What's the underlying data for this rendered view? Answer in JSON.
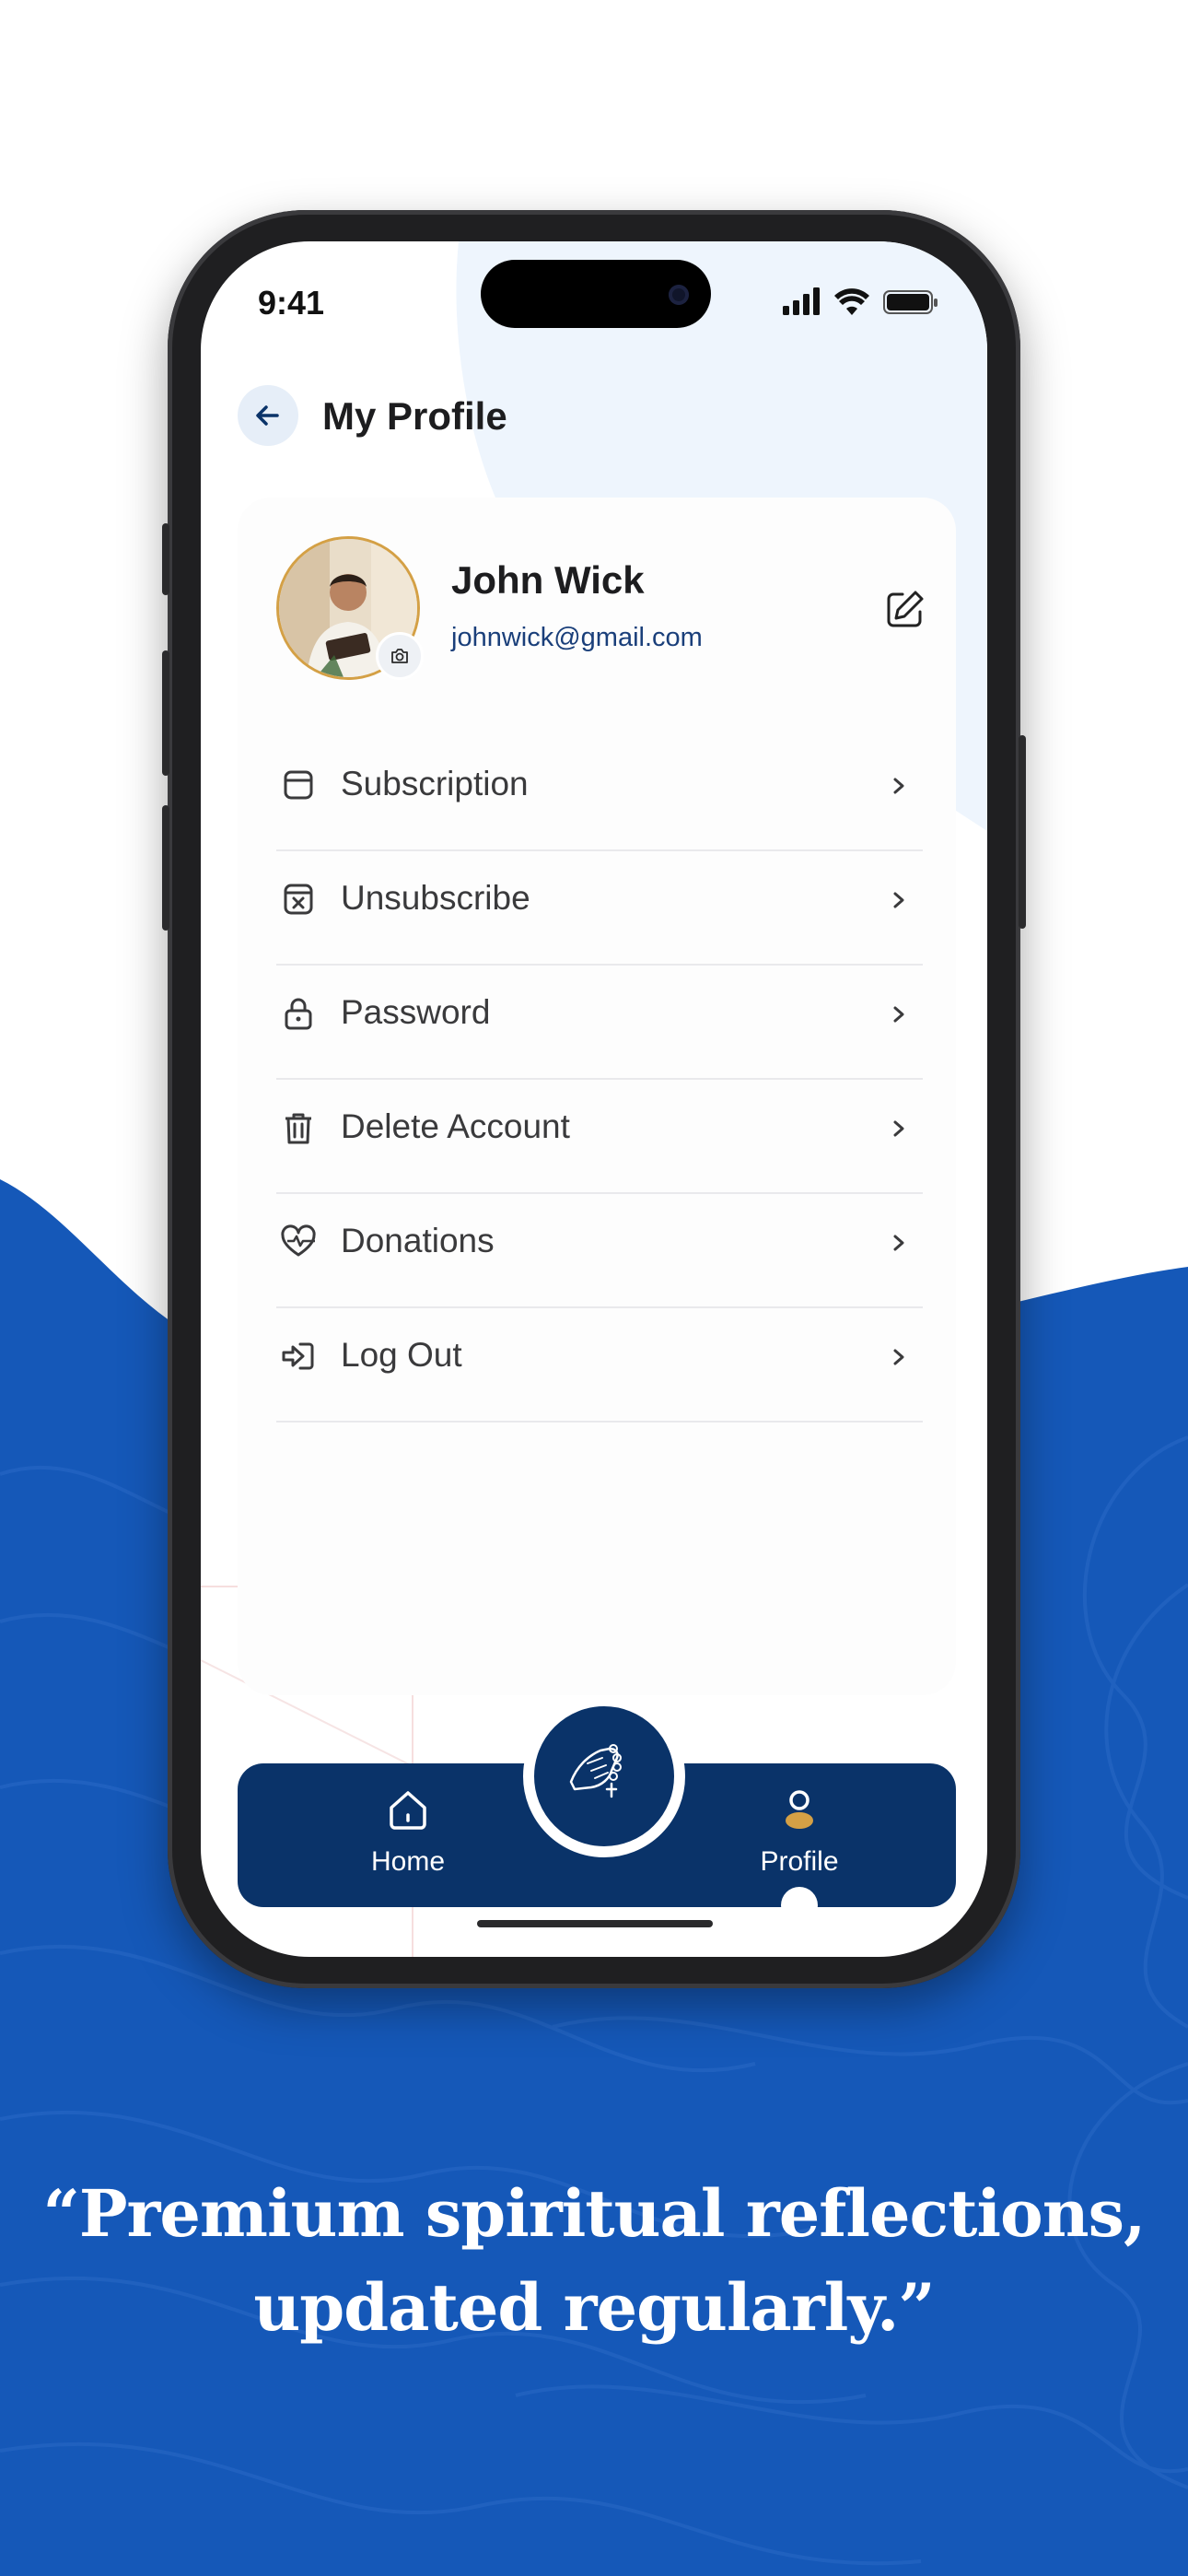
{
  "status_bar": {
    "time": "9:41"
  },
  "header": {
    "title": "My Profile"
  },
  "profile": {
    "name": "John Wick",
    "email": "johnwick@gmail.com"
  },
  "menu": [
    {
      "label": "Subscription",
      "icon": "card-icon"
    },
    {
      "label": " Unsubscribe",
      "icon": "unsubscribe-icon"
    },
    {
      "label": "Password",
      "icon": "lock-icon"
    },
    {
      "label": "Delete Account",
      "icon": "trash-icon"
    },
    {
      "label": "Donations",
      "icon": "heart-pulse-icon"
    },
    {
      "label": "Log Out",
      "icon": "logout-icon"
    }
  ],
  "tabbar": {
    "home_label": "Home",
    "profile_label": "Profile",
    "active": "Profile"
  },
  "tagline": {
    "line1": "“Premium spiritual reflections,",
    "line2": "updated regularly.”"
  },
  "colors": {
    "brand_blue": "#1558b8",
    "navy": "#0a3369",
    "gold": "#d4a045"
  }
}
